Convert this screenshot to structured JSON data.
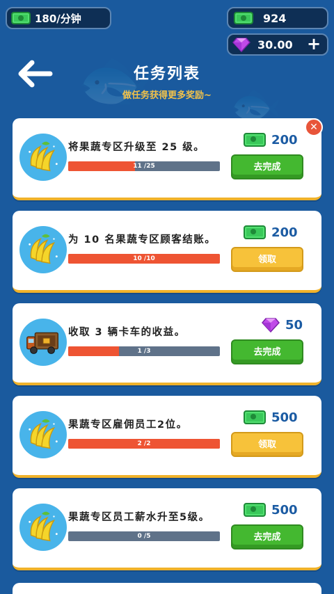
{
  "top_bar": {
    "income_rate": "180/分钟",
    "cash": "924",
    "gems": "30.00",
    "plus_label": "+"
  },
  "header": {
    "title": "任务列表",
    "subtitle": "做任务获得更多奖励~"
  },
  "tasks": [
    {
      "icon": "banana-icon",
      "description": "将果蔬专区升级至 25 级。",
      "progress_text": "11 /25",
      "progress": 0.44,
      "reward_type": "cash",
      "reward": "200",
      "action": "去完成",
      "action_state": "go"
    },
    {
      "icon": "banana-icon",
      "description": "为 10 名果蔬专区顾客结账。",
      "progress_text": "10 /10",
      "progress": 1.0,
      "reward_type": "cash",
      "reward": "200",
      "action": "领取",
      "action_state": "claim"
    },
    {
      "icon": "truck-icon",
      "description": "收取 3 辆卡车的收益。",
      "progress_text": "1 /3",
      "progress": 0.333,
      "reward_type": "gem",
      "reward": "50",
      "action": "去完成",
      "action_state": "go"
    },
    {
      "icon": "banana-icon",
      "description": "果蔬专区雇佣员工2位。",
      "progress_text": "2 /2",
      "progress": 1.0,
      "reward_type": "cash",
      "reward": "500",
      "action": "领取",
      "action_state": "claim"
    },
    {
      "icon": "banana-icon",
      "description": "果蔬专区员工薪水升至5级。",
      "progress_text": "0 /5",
      "progress": 0.0,
      "reward_type": "cash",
      "reward": "500",
      "action": "去完成",
      "action_state": "go"
    }
  ],
  "colors": {
    "background": "#1a5a9e",
    "progress_fill": "#ee5433",
    "go_button": "#44b830",
    "claim_button": "#f7c23a",
    "card_border": "#f0b22a"
  }
}
